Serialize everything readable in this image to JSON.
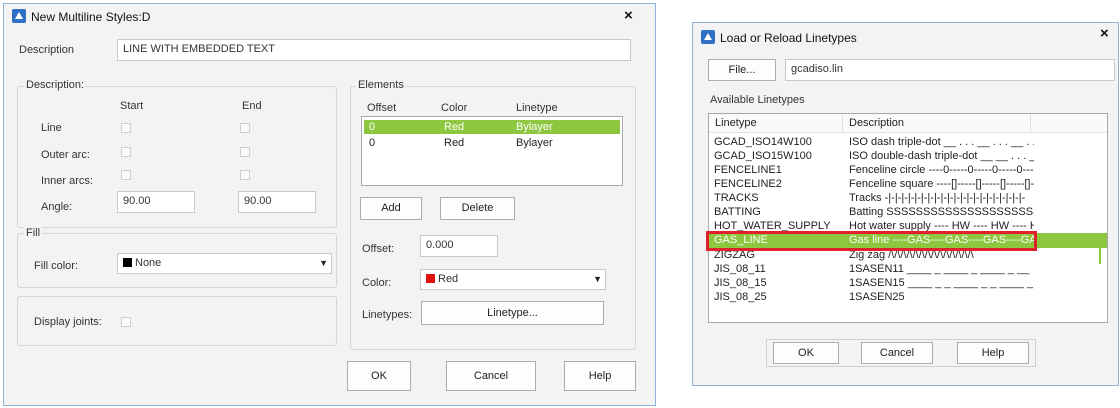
{
  "mls": {
    "title": "New Multiline Styles:D",
    "description_label": "Description",
    "description_value": "LINE WITH EMBEDDED TEXT",
    "caps": {
      "group_title": "Description:",
      "start_header": "Start",
      "end_header": "End",
      "line_label": "Line",
      "outer_arc_label": "Outer arc:",
      "inner_arcs_label": "Inner arcs:",
      "angle_label": "Angle:",
      "start_angle": "90.00",
      "end_angle": "90.00"
    },
    "fill": {
      "group_title": "Fill",
      "fill_color_label": "Fill color:",
      "fill_color_value": "None"
    },
    "display_joints_label": "Display joints:",
    "elements": {
      "group_title": "Elements",
      "columns": [
        "Offset",
        "Color",
        "Linetype"
      ],
      "rows": [
        {
          "offset": "0",
          "color": "Red",
          "linetype": "Bylayer"
        },
        {
          "offset": "0",
          "color": "Red",
          "linetype": "Bylayer"
        }
      ],
      "add_label": "Add",
      "delete_label": "Delete",
      "offset_label": "Offset:",
      "offset_value": "0.000",
      "color_label": "Color:",
      "color_value": "Red",
      "linetypes_label": "Linetypes:",
      "linetype_button": "Linetype..."
    },
    "ok_label": "OK",
    "cancel_label": "Cancel",
    "help_label": "Help"
  },
  "lt": {
    "title": "Load or Reload Linetypes",
    "file_button": "File...",
    "file_value": "gcadiso.lin",
    "available_label": "Available Linetypes",
    "columns": [
      "Linetype",
      "Description"
    ],
    "rows": [
      {
        "name": "GCAD_ISO14W100",
        "desc": "ISO dash triple-dot __ . . . __ . . . __ . . ."
      },
      {
        "name": "GCAD_ISO15W100",
        "desc": "ISO double-dash triple-dot __ __ . . . __ __ . . ."
      },
      {
        "name": "FENCELINE1",
        "desc": "Fenceline circle ----0-----0-----0-----0-----0--"
      },
      {
        "name": "FENCELINE2",
        "desc": "Fenceline square ----[]-----[]-----[]-----[]----["
      },
      {
        "name": "TRACKS",
        "desc": "Tracks -|-|-|-|-|-|-|-|-|-|-|-|-|-|-|-|-|-|-|-|-|-"
      },
      {
        "name": "BATTING",
        "desc": "Batting SSSSSSSSSSSSSSSSSSSSSSS"
      },
      {
        "name": "HOT_WATER_SUPPLY",
        "desc": "Hot water supply ---- HW ---- HW ---- H"
      },
      {
        "name": "GAS_LINE",
        "desc": "Gas line ----GAS----GAS----GAS----GAS"
      },
      {
        "name": "ZIGZAG",
        "desc": "Zig zag /\\/\\/\\/\\/\\/\\/\\/\\/\\/\\/\\/\\/\\/\\"
      },
      {
        "name": "JIS_08_11",
        "desc": "1SASEN11 ____ _ ____ _ ____ _ __"
      },
      {
        "name": "JIS_08_15",
        "desc": "1SASEN15 ____ _ _ ____ _ _ ____ _"
      },
      {
        "name": "JIS_08_25",
        "desc": "1SASEN25"
      }
    ],
    "ok_label": "OK",
    "cancel_label": "Cancel",
    "help_label": "Help"
  },
  "colors": {
    "selection_green": "#8dc63f",
    "highlight_red": "#e0202a",
    "swatch_red": "#e01010",
    "swatch_black": "#000000",
    "dialog_border": "#8fb2d8"
  }
}
